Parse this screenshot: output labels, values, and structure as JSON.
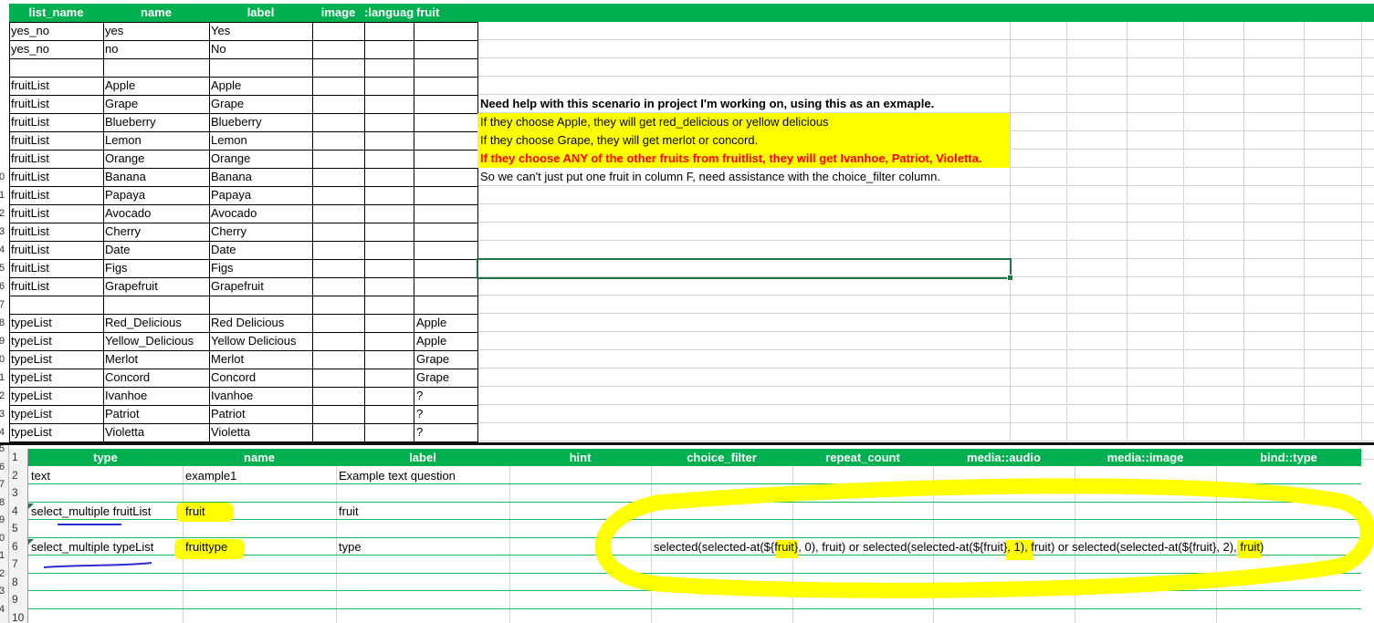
{
  "top_sheet": {
    "headers": [
      "list_name",
      "name",
      "label",
      "image",
      ":languag",
      "fruit"
    ],
    "row_numbers": [
      "",
      "",
      "",
      "",
      "",
      "",
      "",
      "",
      "",
      "0",
      "1",
      "2",
      "3",
      "4",
      "5",
      "6",
      "7",
      "8",
      "9",
      "0",
      "1",
      "2",
      "3",
      "4"
    ],
    "rows": [
      [
        "yes_no",
        "yes",
        "Yes",
        ""
      ],
      [
        "yes_no",
        "no",
        "No",
        ""
      ],
      [
        "",
        "",
        "",
        ""
      ],
      [
        "fruitList",
        "Apple",
        "Apple",
        ""
      ],
      [
        "fruitList",
        "Grape",
        "Grape",
        ""
      ],
      [
        "fruitList",
        "Blueberry",
        "Blueberry",
        ""
      ],
      [
        "fruitList",
        "Lemon",
        "Lemon",
        ""
      ],
      [
        "fruitList",
        "Orange",
        "Orange",
        ""
      ],
      [
        "fruitList",
        "Banana",
        "Banana",
        ""
      ],
      [
        "fruitList",
        "Papaya",
        "Papaya",
        ""
      ],
      [
        "fruitList",
        "Avocado",
        "Avocado",
        ""
      ],
      [
        "fruitList",
        "Cherry",
        "Cherry",
        ""
      ],
      [
        "fruitList",
        "Date",
        "Date",
        ""
      ],
      [
        "fruitList",
        "Figs",
        "Figs",
        ""
      ],
      [
        "fruitList",
        "Grapefruit",
        "Grapefruit",
        ""
      ],
      [
        "",
        "",
        "",
        ""
      ],
      [
        "typeList",
        "Red_Delicious",
        "Red Delicious",
        "Apple"
      ],
      [
        "typeList",
        "Yellow_Delicious",
        "Yellow Delicious",
        "Apple"
      ],
      [
        "typeList",
        "Merlot",
        "Merlot",
        "Grape"
      ],
      [
        "typeList",
        "Concord",
        "Concord",
        "Grape"
      ],
      [
        "typeList",
        "Ivanhoe",
        "Ivanhoe",
        "?"
      ],
      [
        "typeList",
        "Patriot",
        "Patriot",
        "?"
      ],
      [
        "typeList",
        "Violetta",
        "Violetta",
        "?"
      ]
    ],
    "notes": [
      {
        "text": "Need help with this scenario in project I'm working on, using this as an exmaple.",
        "style": "bold"
      },
      {
        "text": "If they choose Apple, they will get red_delicious or yellow delicious",
        "style": "highlight"
      },
      {
        "text": "If they choose Grape, they will get merlot or concord.",
        "style": "highlight"
      },
      {
        "text": "If they choose ANY of the other fruits from fruitlist, they will get Ivanhoe, Patriot, Violetta.",
        "style": "highlight-red"
      },
      {
        "text": "So we can't just put one fruit in column F, need assistance with the choice_filter column.",
        "style": "plain"
      }
    ]
  },
  "bottom_sheet": {
    "outer_row_numbers": [
      "5",
      "6",
      "7",
      "8",
      "9",
      "0",
      "1",
      "2",
      "3",
      "4"
    ],
    "row_numbers": [
      "1",
      "2",
      "3",
      "4",
      "5",
      "6",
      "7",
      "8",
      "9",
      "10"
    ],
    "headers": [
      "type",
      "name",
      "label",
      "hint",
      "choice_filter",
      "repeat_count",
      "media::audio",
      "media::image",
      "bind::type"
    ],
    "rows": [
      {
        "type": "text",
        "name": "example1",
        "label": "Example text question",
        "choice_filter": ""
      },
      {
        "type": "",
        "name": "",
        "label": "",
        "choice_filter": ""
      },
      {
        "type": "select_multiple fruitList",
        "name": "fruit",
        "label": "fruit",
        "choice_filter": ""
      },
      {
        "type": "",
        "name": "",
        "label": "",
        "choice_filter": ""
      },
      {
        "type": "select_multiple typeList",
        "name": "fruittype",
        "label": "type",
        "choice_filter": "selected(selected-at(${fruit}, 0), fruit) or selected(selected-at(${fruit}, 1), fruit) or selected(selected-at(${fruit}, 2), fruit)"
      }
    ]
  },
  "colors": {
    "header_green": "#00b050",
    "highlight_yellow": "#ffff00",
    "red_text": "#ff0000",
    "marker_blue": "#2b2bd6"
  }
}
